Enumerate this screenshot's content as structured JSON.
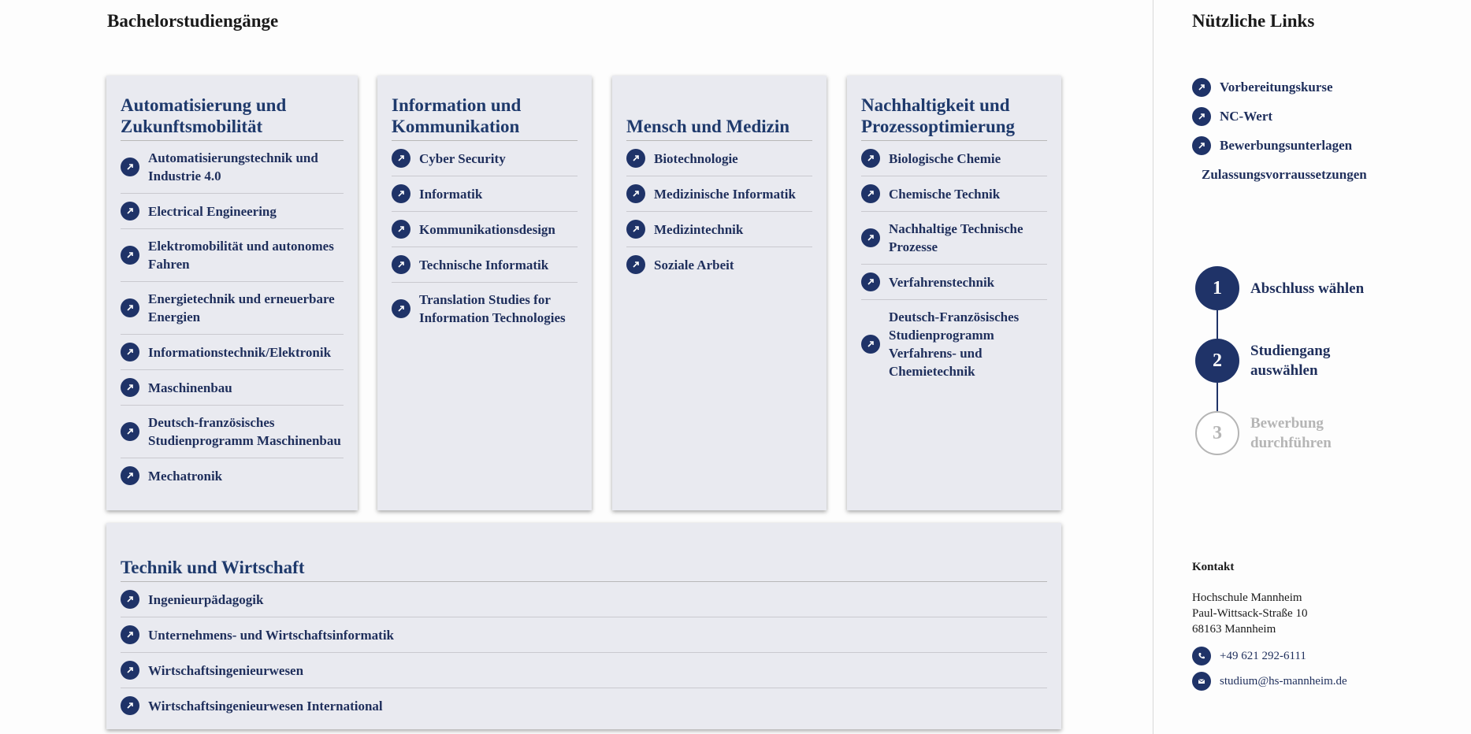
{
  "page_title": "Bachelorstudiengänge",
  "categories": [
    {
      "title": "Automatisierung und Zukunftsmobilität",
      "items": [
        "Automatisierungstechnik und Industrie 4.0",
        "Electrical Engineering",
        "Elektromobilität und autonomes Fahren",
        "Energietechnik und erneuerbare Energien",
        "Informationstechnik/Elektronik",
        "Maschinenbau",
        "Deutsch-französisches Studienprogramm Maschinenbau",
        "Mechatronik"
      ]
    },
    {
      "title": "Information und Kommunikation",
      "items": [
        "Cyber Security",
        "Informatik",
        "Kommunikationsdesign",
        "Technische Informatik",
        "Translation Studies for Information Technologies"
      ]
    },
    {
      "title": "Mensch und Medizin",
      "items": [
        "Biotechnologie",
        "Medizinische Informatik",
        "Medizintechnik",
        "Soziale Arbeit"
      ]
    },
    {
      "title": "Nachhaltigkeit und Prozessoptimierung",
      "items": [
        "Biologische Chemie",
        "Chemische Technik",
        "Nachhaltige Technische Prozesse",
        "Verfahrenstechnik",
        "Deutsch-Französisches Studienprogramm Verfahrens- und Chemietechnik"
      ]
    },
    {
      "title": "Technik und Wirtschaft",
      "items": [
        "Ingenieurpädagogik",
        "Unternehmens- und Wirtschaftsinformatik",
        "Wirtschaftsingenieurwesen",
        "Wirtschaftsingenieurwesen International"
      ]
    }
  ],
  "sidebar": {
    "title": "Nützliche Links",
    "links": [
      "Vorbereitungskurse",
      "NC-Wert",
      "Bewerbungsunterlagen",
      "Zulassungsvorraussetzungen"
    ],
    "steps": [
      {
        "number": "1",
        "label": "Abschluss wählen"
      },
      {
        "number": "2",
        "label": "Studiengang auswählen"
      },
      {
        "number": "3",
        "label": "Bewerbung durchführen"
      }
    ],
    "contact": {
      "title": "Kontakt",
      "org": "Hochschule Mannheim",
      "street": "Paul-Wittsack-Straße 10",
      "city": "68163 Mannheim",
      "phone": "+49 621 292-6111",
      "email": "studium@hs-mannheim.de"
    }
  },
  "colors": {
    "accent": "#1f3368",
    "card_bg": "#e9eaf0",
    "inactive": "#b5b5b5"
  }
}
